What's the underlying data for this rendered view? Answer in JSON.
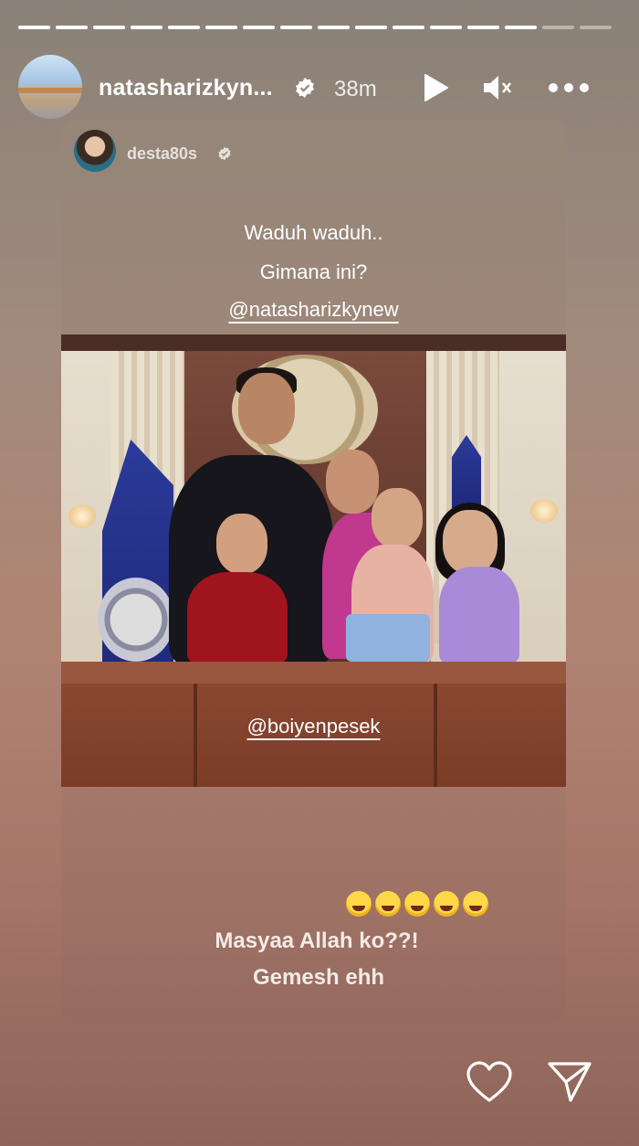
{
  "progress": {
    "segments": 16,
    "completed": 14
  },
  "header": {
    "username": "natasharizkyn...",
    "verified": true,
    "time": "38m",
    "icons": {
      "play": "play-icon",
      "mute": "mute-icon",
      "more": "more-icon"
    }
  },
  "reshare": {
    "username": "desta80s",
    "verified": true,
    "caption_lines": [
      "Waduh waduh..",
      "Gimana ini?"
    ],
    "mention_top": "@natasharizkynew",
    "mention_photo": "@boiyenpesek",
    "emoji_count": 5,
    "emoji_name": "tears-of-joy",
    "bottom_lines": [
      "Masyaa Allah ko??!",
      "Gemesh ehh"
    ]
  },
  "actions": {
    "like": "heart-icon",
    "share": "send-icon"
  },
  "colors": {
    "text": "#ffffff",
    "verified": "#ffffff"
  }
}
